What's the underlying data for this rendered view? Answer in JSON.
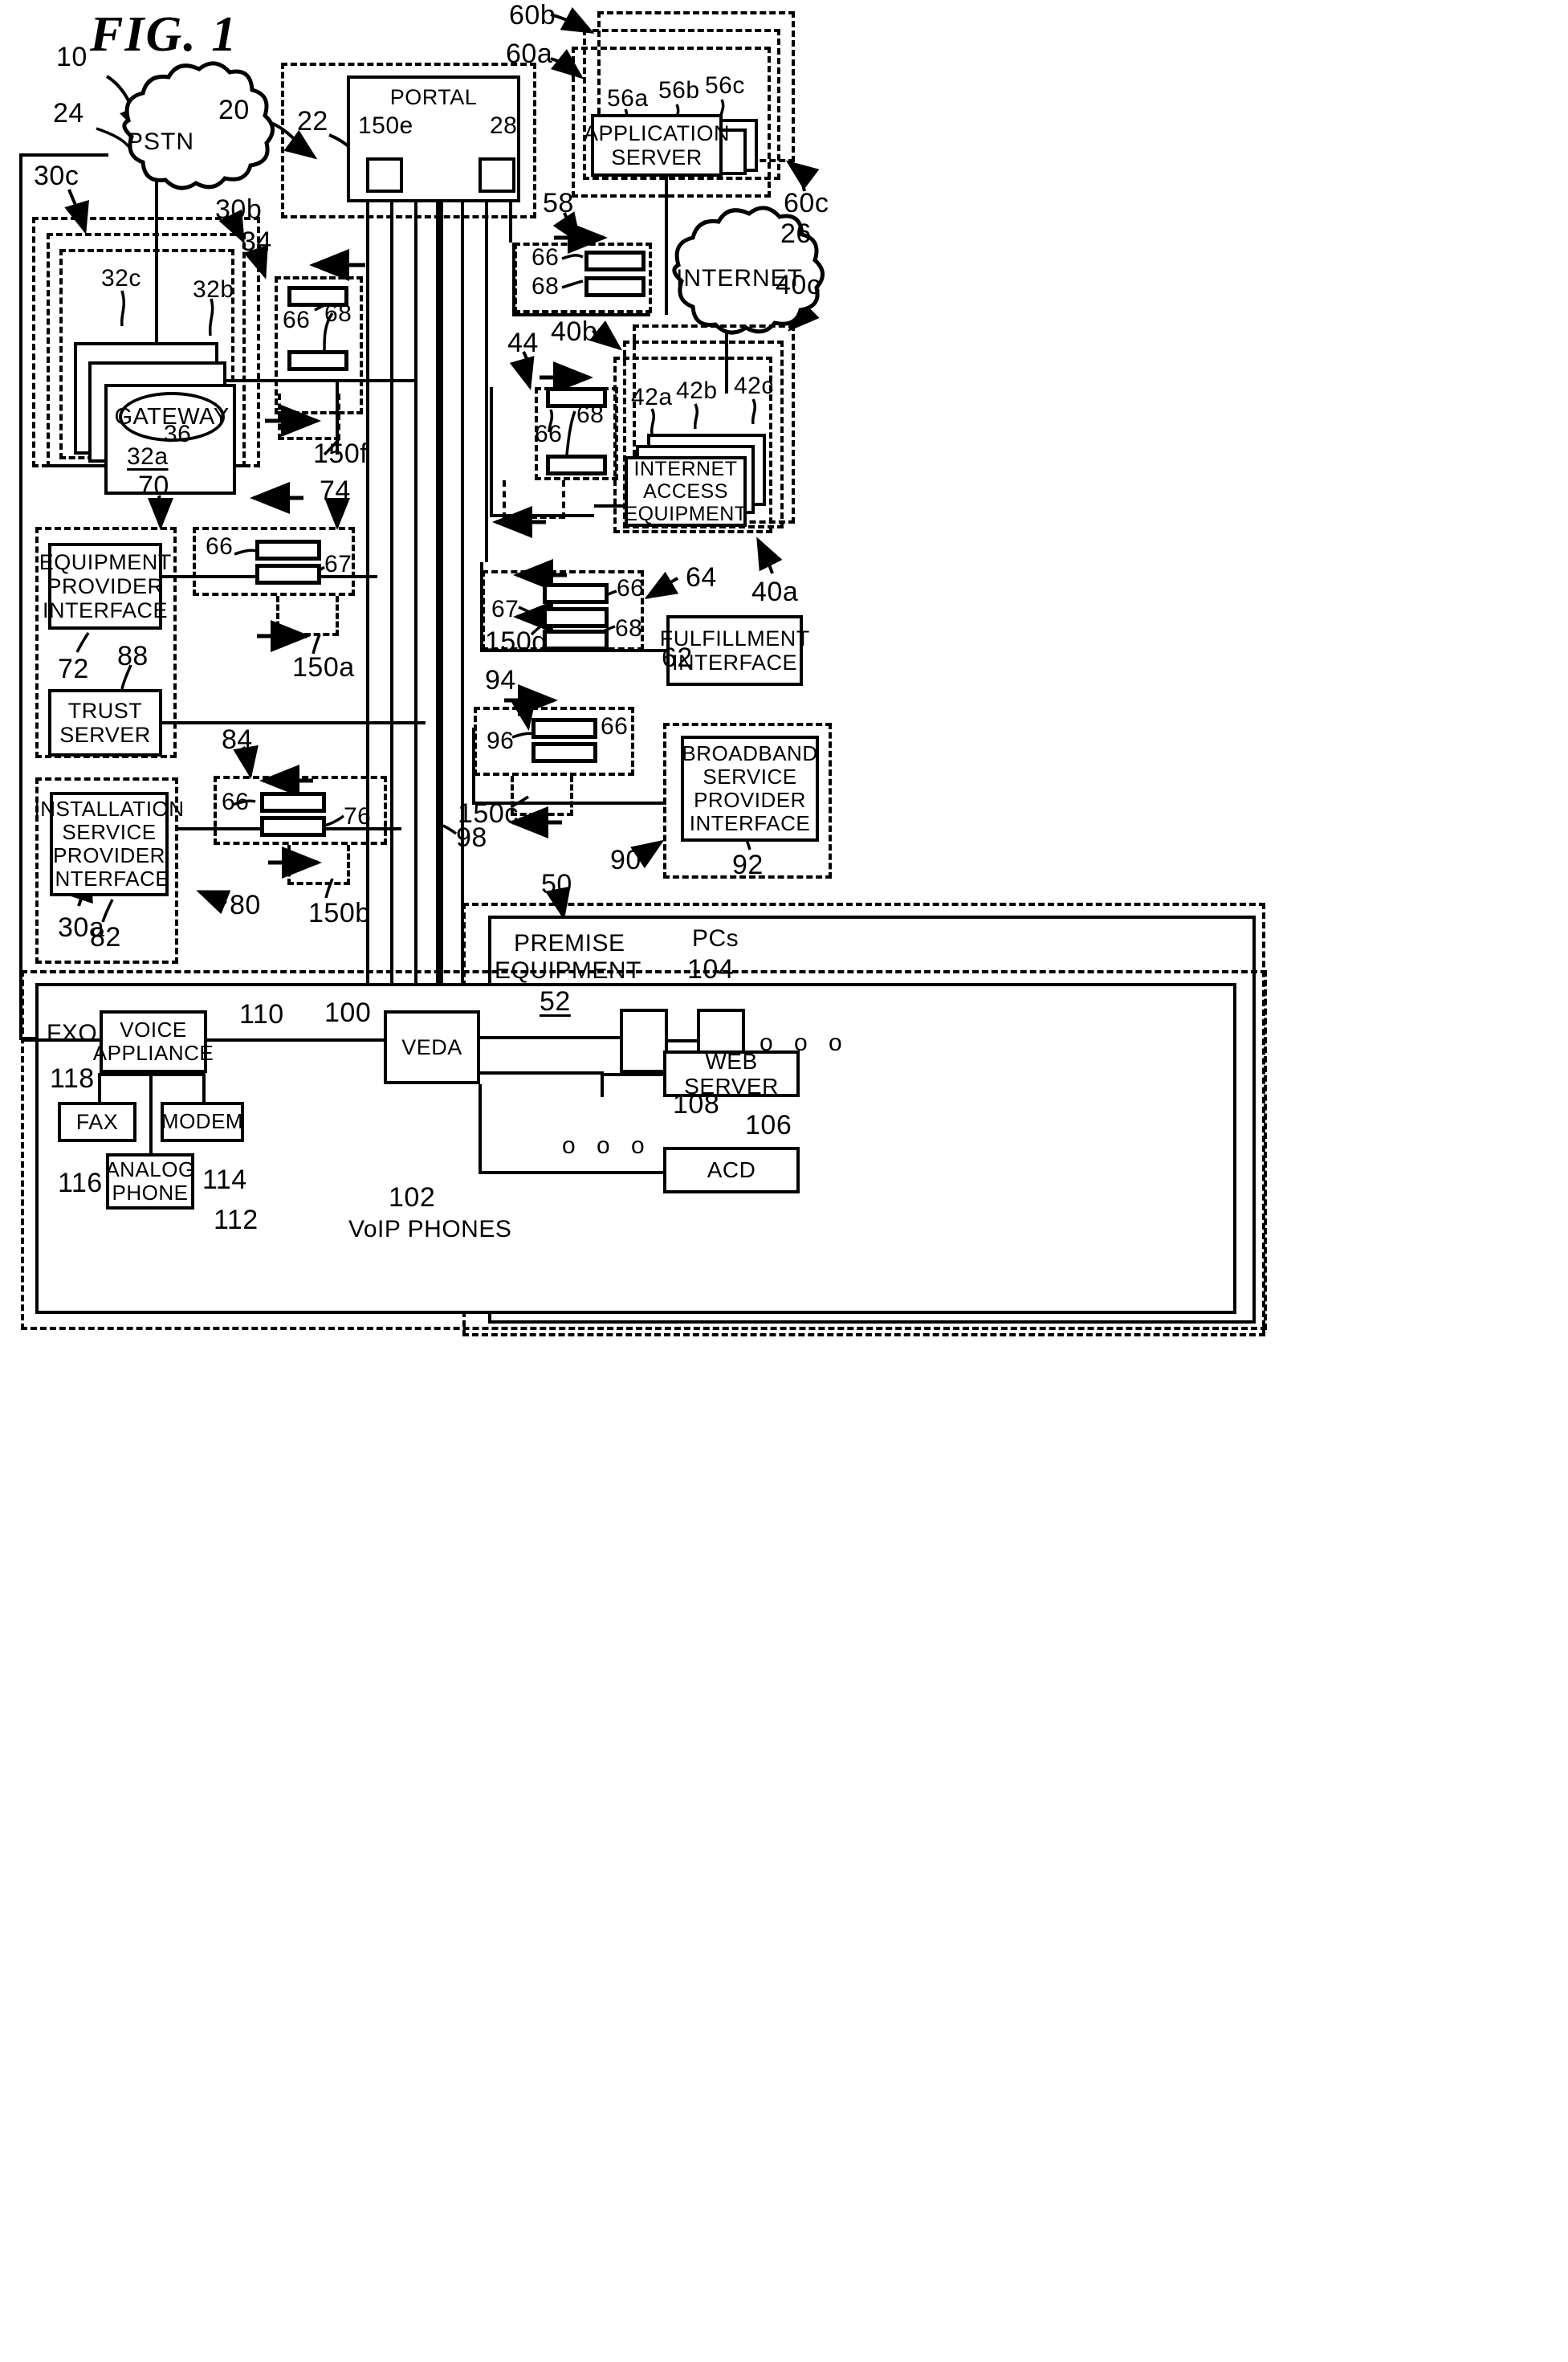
{
  "figure": {
    "title": "FIG. 1",
    "system_ref": "10"
  },
  "clouds": {
    "pstn": {
      "label": "PSTN",
      "ref": "24"
    },
    "internet": {
      "label": "INTERNET",
      "ref": "26"
    }
  },
  "portal": {
    "label": "PORTAL",
    "ref_domain": "20",
    "ref_box": "22",
    "ref_left_item": "150e",
    "ref_right_item": "28"
  },
  "application_servers": {
    "label": "APPLICATION SERVER",
    "refs": [
      "56a",
      "56b",
      "56c"
    ],
    "domain_refs": [
      "60a",
      "60b",
      "60c"
    ]
  },
  "gateways": {
    "label": "GATEWAY",
    "card_refs": [
      "32a",
      "32b",
      "32c"
    ],
    "gateway_ref": "36",
    "domain_refs": [
      "30a",
      "30b",
      "30c"
    ]
  },
  "internet_access": {
    "label": "INTERNET ACCESS EQUIPMENT",
    "card_refs": [
      "42a",
      "42b",
      "42c"
    ],
    "domain_refs": [
      "40a",
      "40b",
      "40c"
    ]
  },
  "interfaces": {
    "equipment_provider": {
      "label": "EQUIPMENT PROVIDER INTERFACE",
      "ref": "72",
      "domain_ref": "70"
    },
    "trust_server": {
      "label": "TRUST SERVER",
      "ref": "88"
    },
    "installation_service_provider": {
      "label": "INSTALLATION SERVICE PROVIDER INTERFACE",
      "ref": "82",
      "domain_ref": "80"
    },
    "fulfillment": {
      "label": "FULFILLMENT INTERFACE",
      "ref": "62"
    },
    "broadband_service_provider": {
      "label": "BROADBAND SERVICE PROVIDER INTERFACE",
      "ref": "92",
      "domain_ref": "90"
    }
  },
  "message_groups": [
    {
      "ref": "34",
      "flow_ref": "150f",
      "items": [
        "66",
        "68"
      ]
    },
    {
      "ref": "58",
      "items": [
        "66",
        "68"
      ]
    },
    {
      "ref": "44",
      "flow_ref": "150d",
      "items": [
        "66",
        "68"
      ]
    },
    {
      "ref": "74",
      "flow_ref": "150a",
      "items": [
        "66",
        "67"
      ]
    },
    {
      "ref": "64",
      "items": [
        "67",
        "66",
        "68"
      ]
    },
    {
      "ref": "84",
      "flow_ref": "150b",
      "items": [
        "66",
        "76"
      ]
    },
    {
      "ref": "94",
      "flow_ref": "150c",
      "items": [
        "96",
        "66"
      ]
    }
  ],
  "premise": {
    "label_line1": "PREMISE",
    "label_line2": "EQUIPMENT",
    "ref": "52",
    "domain_ref": "50",
    "bus_ref": "98",
    "veda": {
      "label": "VEDA",
      "ref": "100"
    },
    "pcs": {
      "label": "PCs",
      "ref": "104"
    },
    "web_server": {
      "label": "WEB SERVER",
      "ref": "106"
    },
    "acd": {
      "label": "ACD",
      "ref": "108"
    },
    "voice_appliance": {
      "label": "VOICE APPLIANCE",
      "ref": "110"
    },
    "fxo": {
      "label": "FXO",
      "ref": "118"
    },
    "fax": {
      "label": "FAX",
      "ref": "116"
    },
    "modem": {
      "label": "MODEM",
      "ref": "114"
    },
    "analog_phone": {
      "label": "ANALOG PHONE",
      "ref": "112"
    },
    "voip_phones": {
      "label": "VoIP PHONES",
      "ref": "102"
    },
    "ellipsis": "o o o"
  },
  "colors": {
    "ink": "#000000",
    "paper": "#ffffff"
  }
}
